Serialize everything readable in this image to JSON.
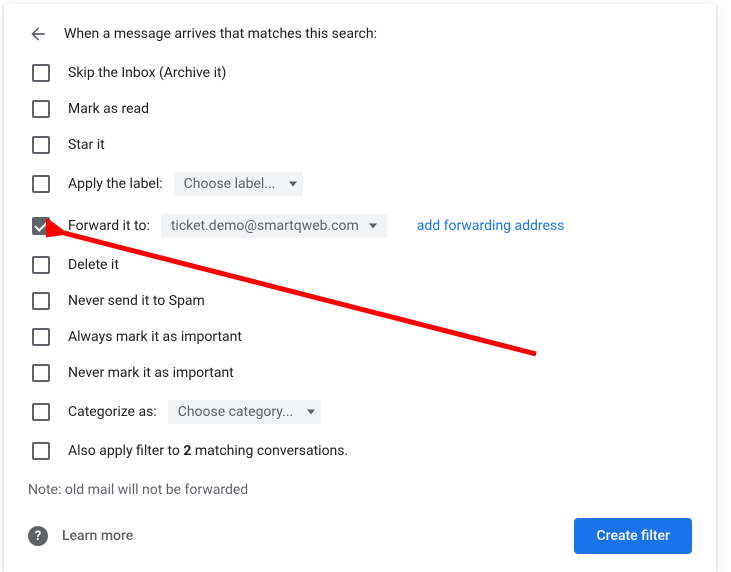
{
  "header": {
    "title": "When a message arrives that matches this search:"
  },
  "options": {
    "skip_inbox": {
      "label": "Skip the Inbox (Archive it)",
      "checked": false
    },
    "mark_read": {
      "label": "Mark as read",
      "checked": false
    },
    "star": {
      "label": "Star it",
      "checked": false
    },
    "apply_label": {
      "label": "Apply the label:",
      "dropdown": "Choose label...",
      "checked": false
    },
    "forward": {
      "label": "Forward it to:",
      "dropdown": "ticket.demo@smartqweb.com",
      "link": "add forwarding address",
      "checked": true
    },
    "delete": {
      "label": "Delete it",
      "checked": false
    },
    "never_spam": {
      "label": "Never send it to Spam",
      "checked": false
    },
    "always_important": {
      "label": "Always mark it as important",
      "checked": false
    },
    "never_important": {
      "label": "Never mark it as important",
      "checked": false
    },
    "categorize": {
      "label": "Categorize as:",
      "dropdown": "Choose category...",
      "checked": false
    },
    "also_apply": {
      "prefix": "Also apply filter to ",
      "count": "2",
      "suffix": " matching conversations.",
      "checked": false
    }
  },
  "note": "Note: old mail will not be forwarded",
  "footer": {
    "learn_more": "Learn more",
    "create_filter": "Create filter"
  }
}
